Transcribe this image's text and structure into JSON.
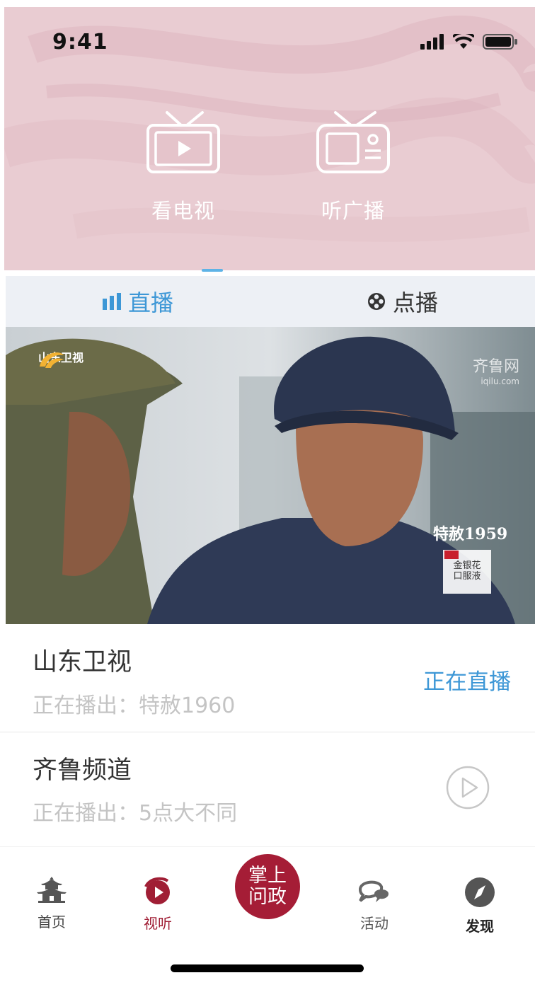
{
  "status_bar": {
    "time": "9:41"
  },
  "header": {
    "media_buttons": [
      {
        "label": "看电视",
        "icon": "tv-icon"
      },
      {
        "label": "听广播",
        "icon": "radio-icon"
      }
    ],
    "background_color": "#e9ccd2"
  },
  "subtabs": [
    {
      "label": "直播",
      "icon": "bar-chart-icon",
      "active": true
    },
    {
      "label": "点播",
      "icon": "film-reel-icon",
      "active": false
    }
  ],
  "player": {
    "station_logo_text": "山东卫视",
    "watermark": "齐鲁网",
    "watermark_sub": "iqilu.com",
    "program_title": "特赦1959",
    "ad_lines": [
      "金银花",
      "口服液"
    ]
  },
  "channels": [
    {
      "name": "山东卫视",
      "now_playing": "正在播出：特赦1960",
      "status": "正在直播"
    },
    {
      "name": "齐鲁频道",
      "now_playing": "正在播出：5点大不同",
      "action_icon": "play-circle-icon"
    }
  ],
  "tabbar": {
    "items": [
      {
        "label": "首页",
        "icon": "pagoda-icon"
      },
      {
        "label": "视听",
        "icon": "play-circle-filled-icon",
        "active": true
      },
      {
        "label": "活动",
        "icon": "chat-bubbles-icon"
      },
      {
        "label": "发现",
        "icon": "compass-icon"
      }
    ],
    "center_button": {
      "line1": "掌上",
      "line2": "问政"
    },
    "accent_color": "#a51d36"
  },
  "colors": {
    "accent_blue": "#3d97d6",
    "muted_text": "#c4c4c4"
  }
}
